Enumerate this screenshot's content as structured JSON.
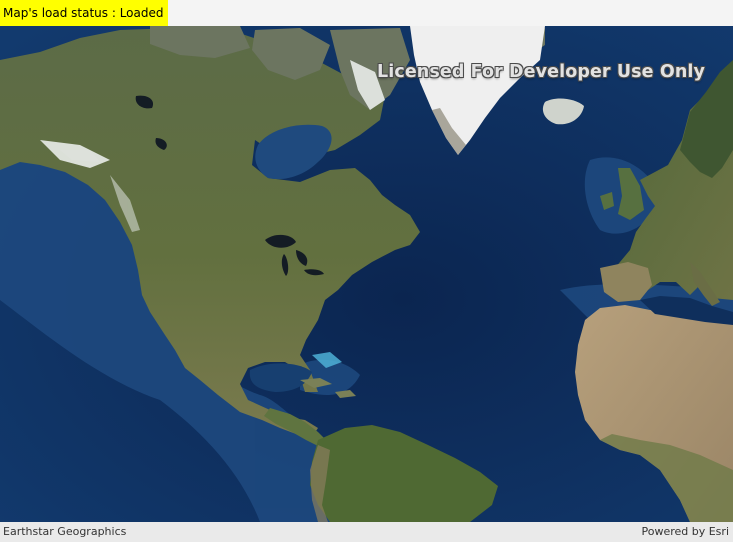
{
  "status": {
    "text": "Map's load status : Loaded",
    "highlight_color": "#ffff00"
  },
  "map": {
    "basemap": "imagery",
    "watermark": "Licensed For Developer Use Only",
    "colors": {
      "ocean_deep": "#0c2a52",
      "ocean_shelf": "#1f4c85",
      "land_forest": "#53663a",
      "land_plains": "#6f7448",
      "land_desert": "#b09c77",
      "ice": "#efefef",
      "lakes": "#141c24"
    }
  },
  "attribution": {
    "source": "Earthstar Geographics",
    "powered_by": "Powered by Esri"
  }
}
